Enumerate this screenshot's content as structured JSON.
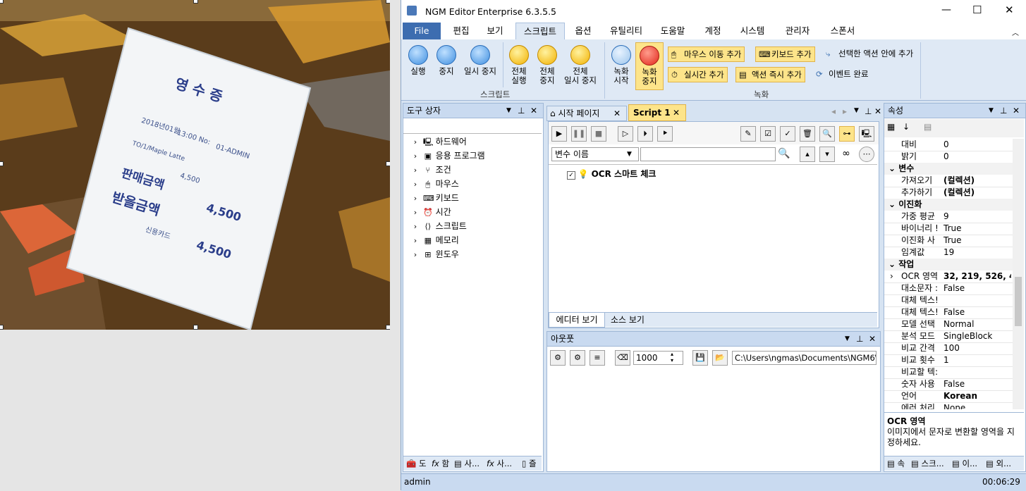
{
  "receipt": {
    "title": "영 수 증",
    "date": "2018년01월",
    "time": "13:00 No:",
    "admin": "01-ADMIN",
    "item": "TO/1/Maple Latte",
    "price": "4,500",
    "total_label": "판매금액",
    "pay_label": "받을금액",
    "total": "4,500",
    "card_label": "신용카드"
  },
  "window": {
    "title": "NGM Editor",
    "edition": "Enterprise 6.3.5.5",
    "controls": {
      "minimize": "—",
      "maximize": "☐",
      "close": "✕"
    }
  },
  "ribbon_tabs": [
    "File",
    "편집",
    "보기",
    "스크립트",
    "옵션",
    "유틸리티",
    "도움말",
    "계정",
    "시스템",
    "관리자",
    "스폰서"
  ],
  "ribbon": {
    "script_group": {
      "label": "스크립트",
      "run": "실행",
      "stop": "중지",
      "pause": "일시 중지",
      "run_all_1": "전체",
      "run_all_2": "실행",
      "stop_all_1": "전체",
      "stop_all_2": "중지",
      "pause_all_1": "전체",
      "pause_all_2": "일시 중지"
    },
    "record_group": {
      "label": "녹화",
      "rec_start_1": "녹화",
      "rec_start_2": "시작",
      "rec_stop_1": "녹화",
      "rec_stop_2": "중지",
      "mouse_move": "마우스 이동 추가",
      "keyboard": "키보드 추가",
      "add_in_selected": "선택한 액션 안에 추가",
      "realtime": "실시간 추가",
      "action_now": "액션 즉시 추가",
      "event_done": "이벤트 완료"
    }
  },
  "toolbox": {
    "title": "도구 상자",
    "items": [
      "하드웨어",
      "응용 프로그램",
      "조건",
      "마우스",
      "키보드",
      "시간",
      "스크립트",
      "메모리",
      "윈도우"
    ],
    "bottom_tabs": [
      "도",
      "함",
      "사...",
      "사...",
      "즐"
    ]
  },
  "doc_tabs": [
    "시작 페이지",
    "Script 1"
  ],
  "editor": {
    "var_select": "변수 이름",
    "search_value": "",
    "node_label": "OCR 스마트 체크",
    "view_tabs": [
      "에디터 보기",
      "소스 보기"
    ]
  },
  "output": {
    "title": "아웃풋",
    "count": "1000",
    "path": "C:\\Users\\ngmas\\Documents\\NGM6\\"
  },
  "properties": {
    "title": "속성",
    "rows": [
      {
        "name": "대비",
        "value": "0"
      },
      {
        "name": "밝기",
        "value": "0"
      }
    ],
    "cat_variable": "변수",
    "variable_rows": [
      {
        "name": "가져오기",
        "value": "(컬렉션)"
      },
      {
        "name": "추가하기",
        "value": "(컬렉션)"
      }
    ],
    "cat_binarize": "이진화",
    "binarize_rows": [
      {
        "name": "가중 평균",
        "value": "9"
      },
      {
        "name": "바이너리 !",
        "value": "True"
      },
      {
        "name": "이진화 사",
        "value": "True"
      },
      {
        "name": "임계값",
        "value": "19"
      }
    ],
    "cat_task": "작업",
    "task_rows": [
      {
        "name": "OCR 영역",
        "value": "32, 219, 526, 4"
      },
      {
        "name": "대소문자 :",
        "value": "False"
      },
      {
        "name": "대체 텍스!",
        "value": ""
      },
      {
        "name": "대체 텍스!",
        "value": "False"
      },
      {
        "name": "모델 선택",
        "value": "Normal"
      },
      {
        "name": "분석 모드",
        "value": "SingleBlock"
      },
      {
        "name": "비교 간격",
        "value": "100"
      },
      {
        "name": "비교 횟수",
        "value": "1"
      },
      {
        "name": "비교할 텍:",
        "value": ""
      },
      {
        "name": "숫자 사용",
        "value": "False"
      },
      {
        "name": "언어",
        "value": "Korean"
      },
      {
        "name": "에러 처리",
        "value": "None"
      }
    ],
    "desc_title": "OCR 영역",
    "desc_text": "이미지에서 문자로 변환할 영역을 지정하세요.",
    "bottom_tabs": [
      "속",
      "스크...",
      "이...",
      "외..."
    ]
  },
  "status": {
    "user": "admin",
    "time": "00:06:29"
  }
}
